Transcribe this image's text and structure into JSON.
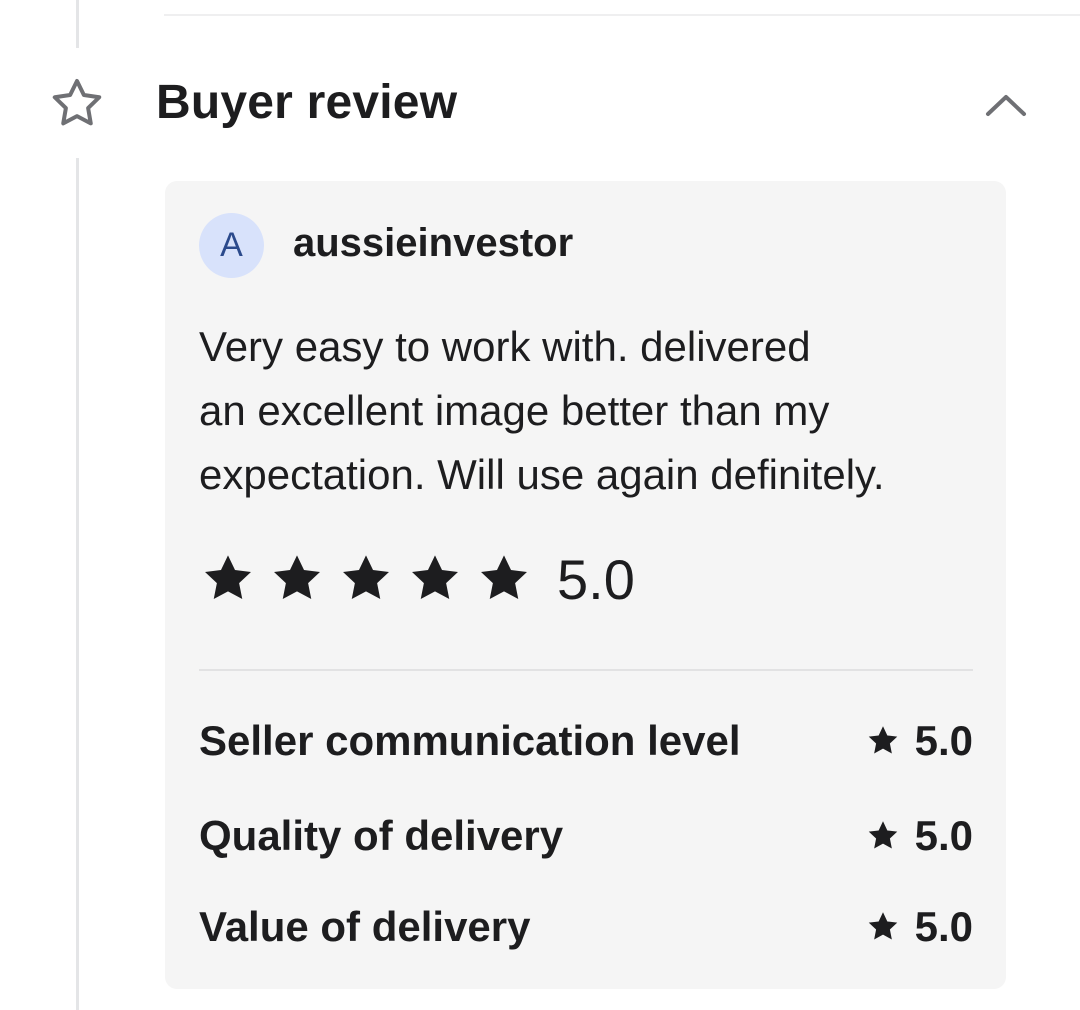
{
  "section": {
    "title": "Buyer review"
  },
  "review": {
    "avatar_initial": "A",
    "username": "aussieinvestor",
    "text": "Very easy to work with.  delivered\nan excellent image better than my\nexpectation. Will use again definitely.",
    "overall_rating": "5.0",
    "star_count": 5,
    "breakdown": [
      {
        "label": "Seller communication level",
        "value": "5.0"
      },
      {
        "label": "Quality of delivery",
        "value": "5.0"
      },
      {
        "label": "Value of delivery",
        "value": "5.0"
      }
    ]
  },
  "colors": {
    "card_background": "#f5f5f5",
    "avatar_background": "#d8e2fb",
    "avatar_text": "#2b4a8c",
    "star_fill": "#1d1d1f",
    "timeline_line": "#e4e5e7"
  },
  "icons": {
    "section_icon": "star-outline-icon",
    "toggle_icon": "chevron-up-icon",
    "rating_icon": "star-filled-icon"
  }
}
